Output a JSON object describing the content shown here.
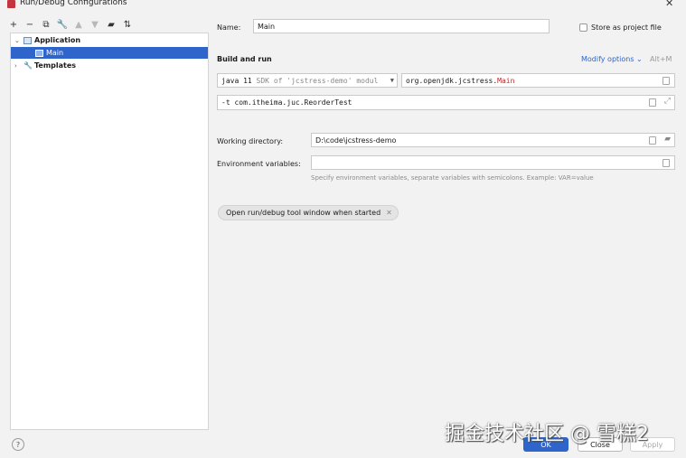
{
  "window": {
    "title": "Run/Debug Configurations"
  },
  "toolbar": {
    "icons": [
      "add-icon",
      "remove-icon",
      "copy-icon",
      "wrench-icon",
      "move-up-icon",
      "move-down-icon",
      "folder-icon",
      "sort-icon"
    ]
  },
  "tree": {
    "application": "Application",
    "main": "Main",
    "templates": "Templates"
  },
  "form": {
    "name_label": "Name:",
    "name_value": "Main",
    "store_label": "Store as project file",
    "section_build": "Build and run",
    "modify_options": "Modify options",
    "modify_shortcut": "Alt+M",
    "sdk_value": "java 11",
    "sdk_detail": "SDK of 'jcstress-demo' modul",
    "main_class_prefix": "org.openjdk.jcstress.",
    "main_class_name": "Main",
    "program_args": "-t com.itheima.juc.ReorderTest",
    "workdir_label": "Working directory:",
    "workdir_value": "D:\\code\\jcstress-demo",
    "env_label": "Environment variables:",
    "env_value": "",
    "env_hint": "Specify environment variables, separate variables with semicolons. Example: VAR=value",
    "chip_label": "Open run/debug tool window when started"
  },
  "buttons": {
    "ok": "OK",
    "close": "Close",
    "apply": "Apply",
    "help": "?"
  },
  "watermark": "掘金技术社区 @ 雪糕2",
  "colors": {
    "accent": "#2f65ca",
    "main_class": "#c7222a"
  }
}
